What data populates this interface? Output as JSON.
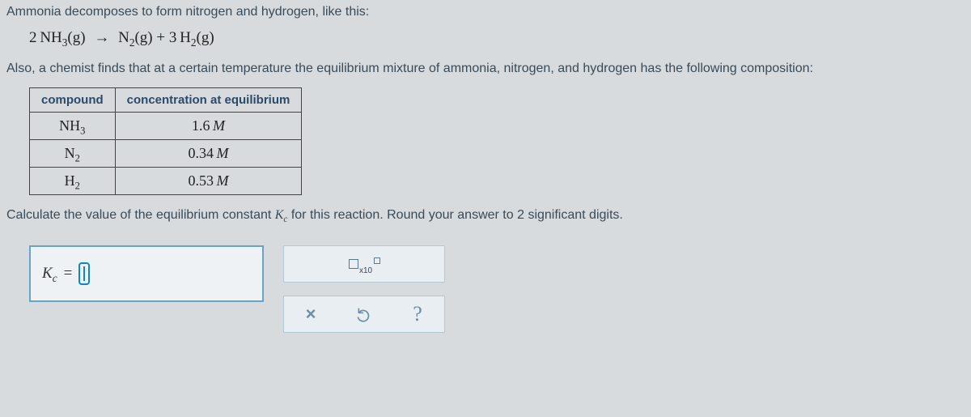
{
  "intro": "Ammonia decomposes to form nitrogen and hydrogen, like this:",
  "equation": {
    "lhs_coef": "2",
    "lhs_species": "NH",
    "lhs_sub": "3",
    "lhs_phase": "(g)",
    "rhs1_species": "N",
    "rhs1_sub": "2",
    "rhs1_phase": "(g)",
    "plus": "+",
    "rhs2_coef": "3",
    "rhs2_species": "H",
    "rhs2_sub": "2",
    "rhs2_phase": "(g)"
  },
  "also": "Also, a chemist finds that at a certain temperature the equilibrium mixture of ammonia, nitrogen, and hydrogen has the following composition:",
  "table": {
    "headers": {
      "c0": "compound",
      "c1": "concentration at equilibrium"
    },
    "rows": [
      {
        "compound": "NH",
        "sub": "3",
        "conc": "1.6",
        "unit": "M"
      },
      {
        "compound": "N",
        "sub": "2",
        "conc": "0.34",
        "unit": "M"
      },
      {
        "compound": "H",
        "sub": "2",
        "conc": "0.53",
        "unit": "M"
      }
    ]
  },
  "calc": {
    "pre": "Calculate the value of the equilibrium constant ",
    "k": "K",
    "ks": "c",
    "post": " for this reaction. Round your answer to ",
    "sig": "2",
    "tail": " significant digits."
  },
  "answer": {
    "k": "K",
    "ks": "c",
    "eq": "=",
    "value": ""
  },
  "toolbar": {
    "x10": "x10",
    "clear": "×",
    "help": "?"
  }
}
